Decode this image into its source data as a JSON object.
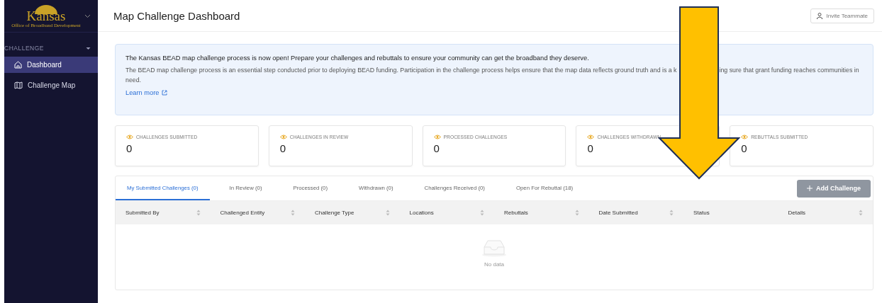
{
  "sidebar": {
    "logo_text": "Kansas",
    "logo_subtitle": "Office of Broadband Development",
    "section": {
      "label": "CHALLENGE",
      "expanded": true
    },
    "items": [
      {
        "label": "Dashboard",
        "selected": true
      },
      {
        "label": "Challenge Map",
        "selected": false
      }
    ]
  },
  "header": {
    "title": "Map Challenge Dashboard",
    "button": "Invite Teammate"
  },
  "banner": {
    "heading": "The Kansas BEAD map challenge process is now open! Prepare your challenges and rebuttals to ensure your community can get the broadband they deserve.",
    "body_before": "The BEAD map challenge process is an essential step conducted prior to deploying BEAD funding. Participation in the challenge process helps ensure that the map data reflects ground truth and is a k",
    "body_after": "ing sure that grant funding reaches communities in",
    "body_end": "need.",
    "link": "Learn more"
  },
  "stats": [
    {
      "label": "CHALLENGES SUBMITTED",
      "value": "0"
    },
    {
      "label": "CHALLENGES IN REVIEW",
      "value": "0"
    },
    {
      "label": "PROCESSED CHALLENGES",
      "value": "0"
    },
    {
      "label": "CHALLENGES WITHDRAWN",
      "value": "0"
    },
    {
      "label": "REBUTTALS SUBMITTED",
      "value": "0"
    }
  ],
  "tabs": [
    {
      "label": "My Submitted Challenges (0)",
      "selected": true
    },
    {
      "label": "In Review (0)",
      "selected": false
    },
    {
      "label": "Processed (0)",
      "selected": false
    },
    {
      "label": "Withdrawn (0)",
      "selected": false
    },
    {
      "label": "Challenges Received (0)",
      "selected": false
    },
    {
      "label": "Open For Rebuttal (18)",
      "selected": false
    }
  ],
  "add_button": {
    "label": "Add Challenge",
    "disabled": true
  },
  "table": {
    "columns": [
      {
        "label": "Submitted By",
        "sortable": true
      },
      {
        "label": "Challenged Entity",
        "sortable": true
      },
      {
        "label": "Challenge Type",
        "sortable": true
      },
      {
        "label": "Locations",
        "sortable": true
      },
      {
        "label": "Rebuttals",
        "sortable": true
      },
      {
        "label": "Date Submitted",
        "sortable": true
      },
      {
        "label": "Status",
        "sortable": false
      },
      {
        "label": "Details",
        "sortable": true
      }
    ],
    "empty_text": "No data"
  },
  "annotation": {
    "kind": "arrow"
  }
}
